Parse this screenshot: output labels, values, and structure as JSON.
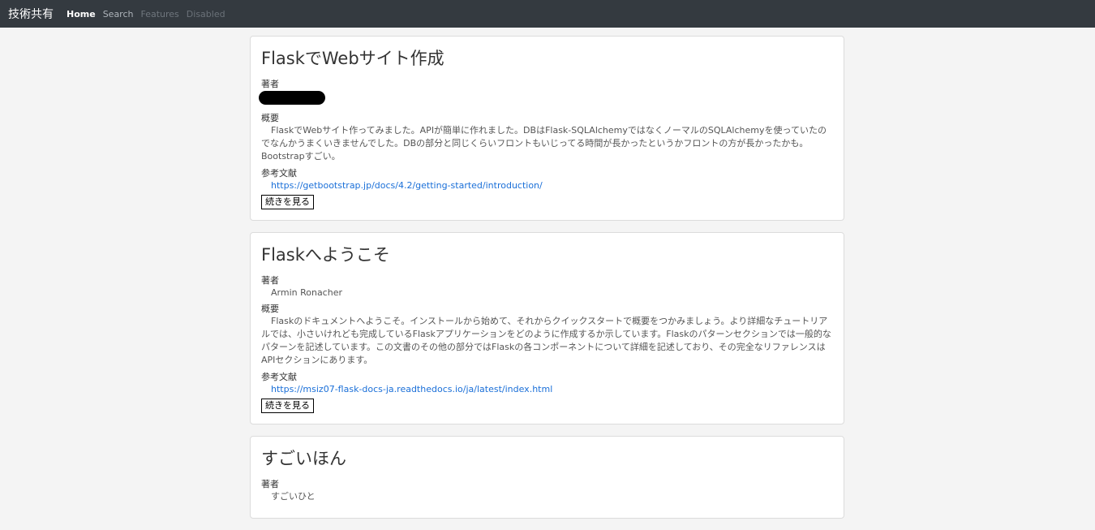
{
  "navbar": {
    "brand": "技術共有",
    "links": [
      {
        "label": "Home"
      },
      {
        "label": "Search"
      },
      {
        "label": "Features"
      },
      {
        "label": "Disabled"
      }
    ]
  },
  "labels": {
    "author": "著者",
    "summary": "概要",
    "references": "参考文献",
    "read_more": "続きを見る"
  },
  "cards": [
    {
      "title": "FlaskでWebサイト作成",
      "author": "",
      "author_redacted": true,
      "summary": "FlaskでWebサイト作ってみました。APIが簡単に作れました。DBはFlask-SQLAlchemyではなくノーマルのSQLAlchemyを使っていたのでなんかうまくいきませんでした。DBの部分と同じくらいフロントもいじってる時間が長かったというかフロントの方が長かったかも。Bootstrapすごい。",
      "reference": "https://getbootstrap.jp/docs/4.2/getting-started/introduction/"
    },
    {
      "title": "Flaskへようこそ",
      "author": "Armin Ronacher",
      "author_redacted": false,
      "summary": "Flaskのドキュメントへようこそ。インストールから始めて、それからクイックスタートで概要をつかみましょう。より詳細なチュートリアルでは、小さいけれども完成しているFlaskアプリケーションをどのように作成するか示しています。Flaskのパターンセクションでは一般的なパターンを記述しています。この文書のその他の部分ではFlaskの各コンポーネントについて詳細を記述しており、その完全なリファレンスはAPIセクションにあります。",
      "reference": "https://msiz07-flask-docs-ja.readthedocs.io/ja/latest/index.html"
    },
    {
      "title": "すごいほん",
      "author": "すごいひと",
      "author_redacted": false,
      "summary": "",
      "reference": ""
    }
  ]
}
